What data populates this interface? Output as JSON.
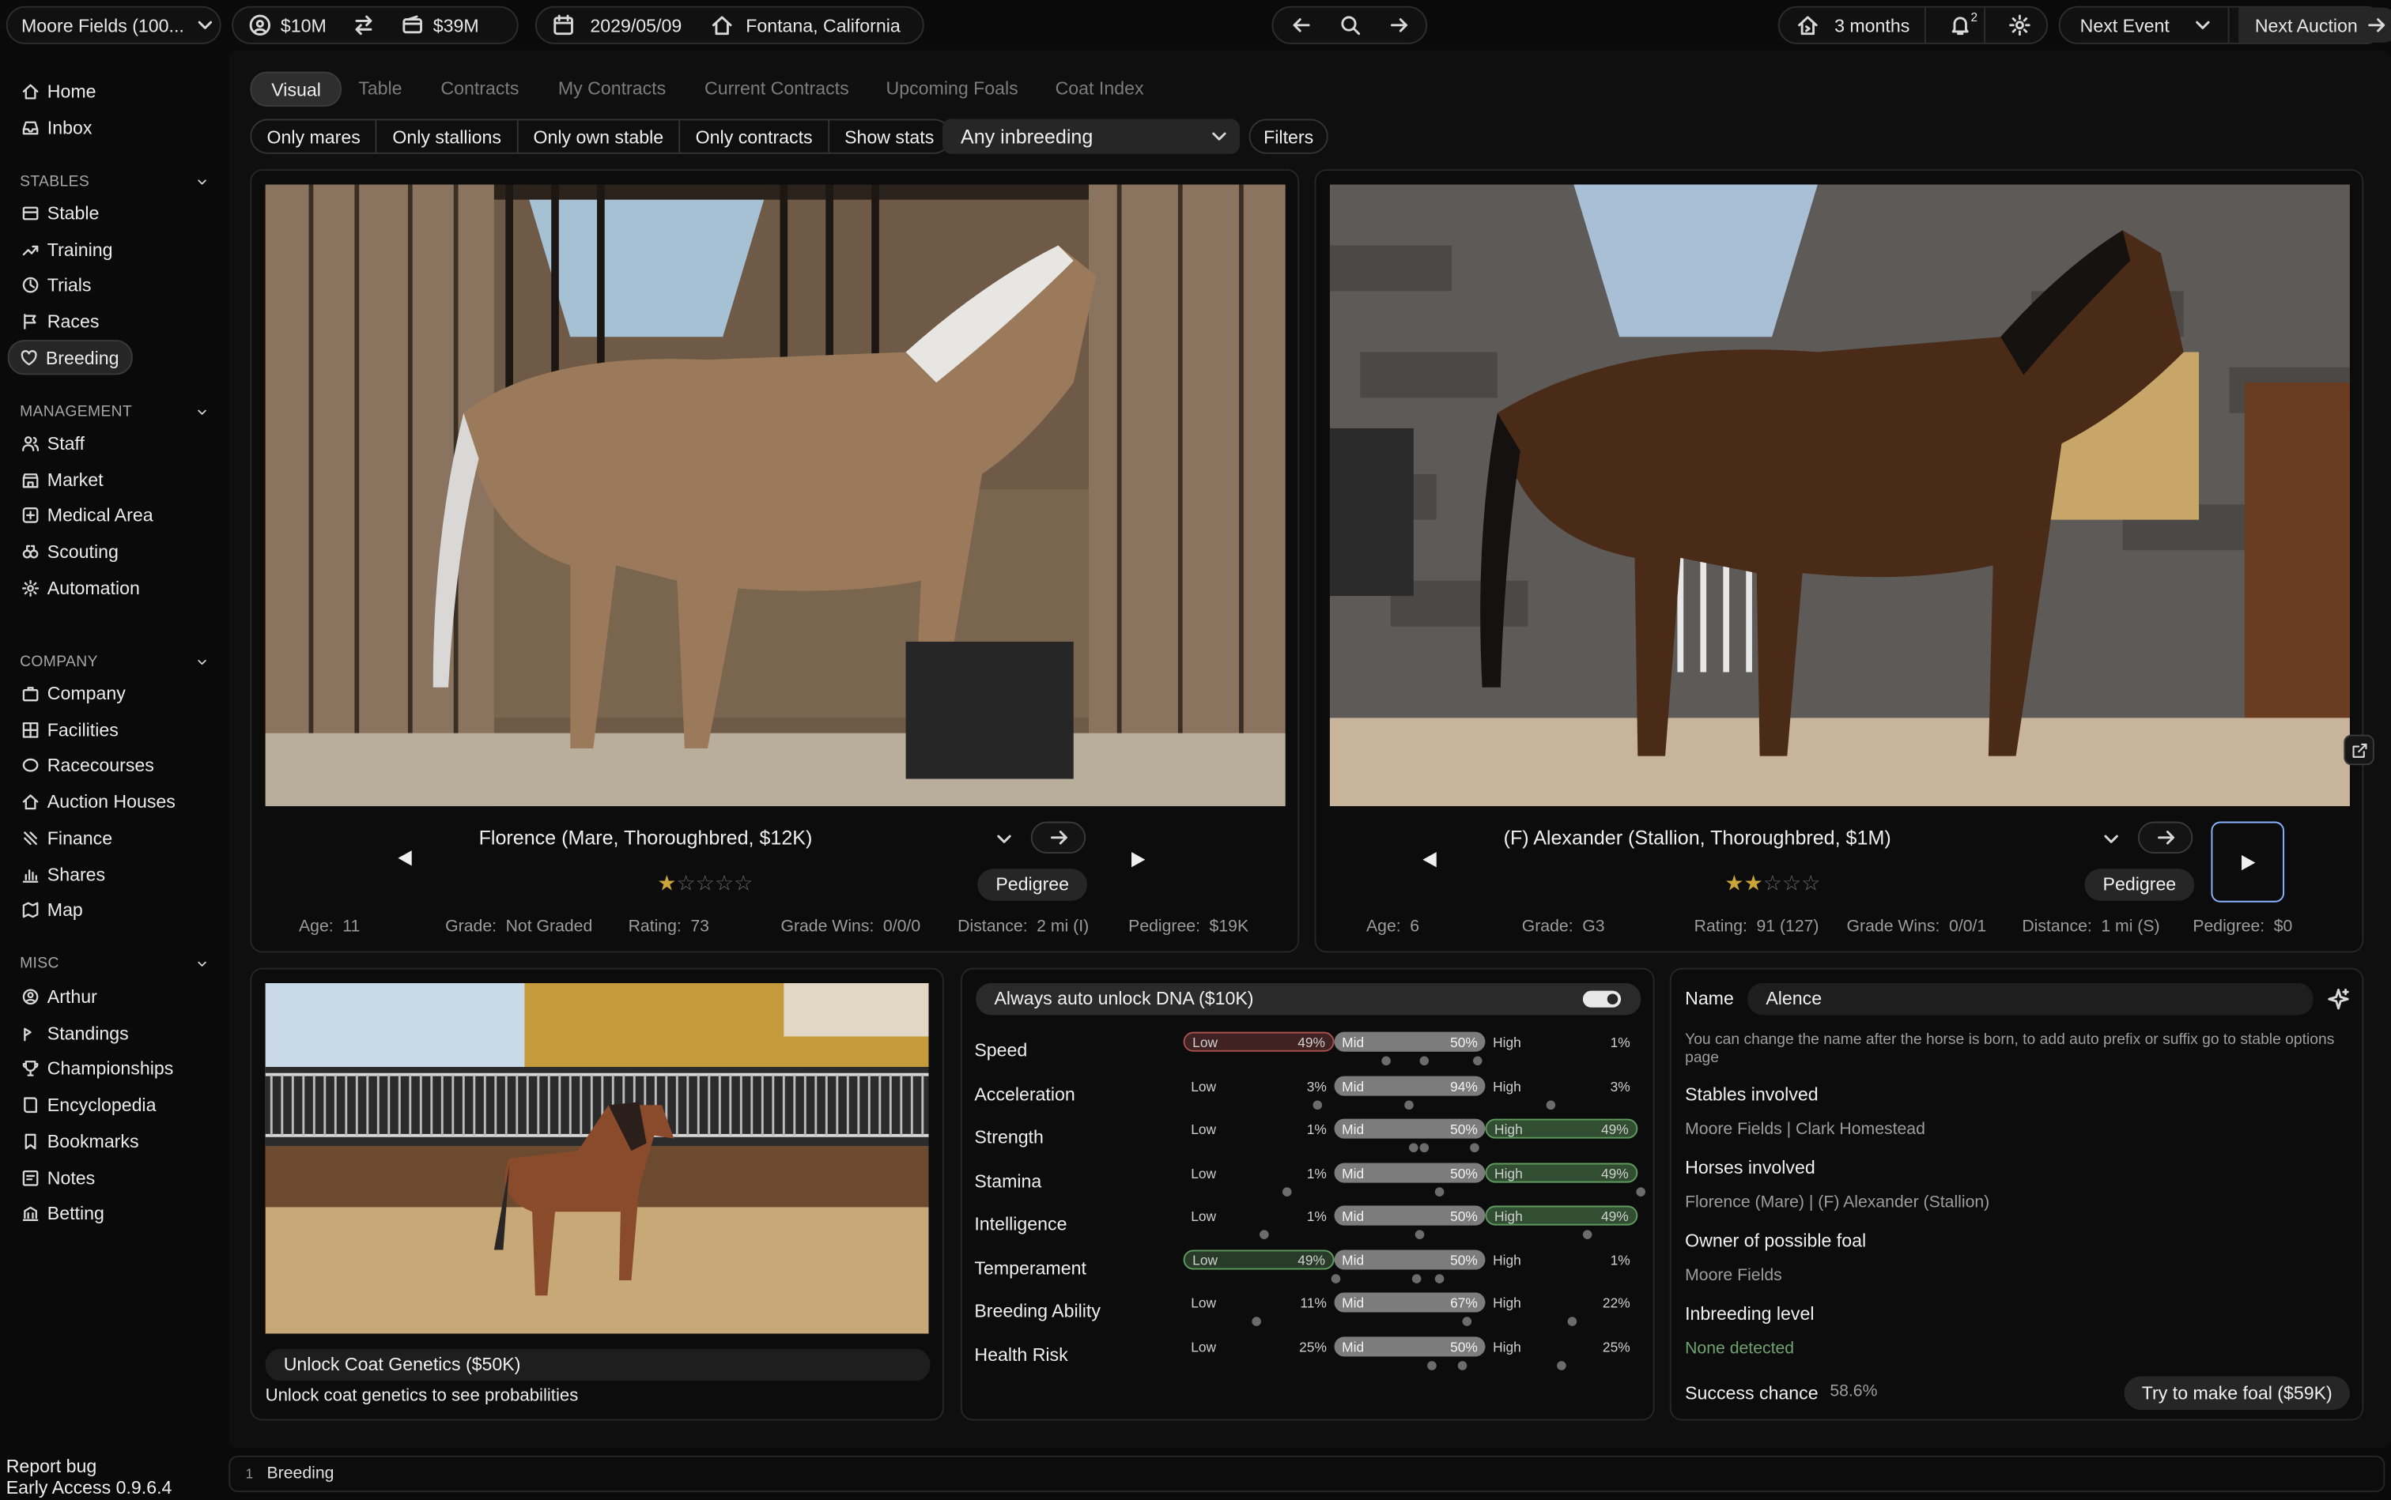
{
  "topbar": {
    "stable_name": "Moore Fields (100...",
    "cash": "$10M",
    "net_worth": "$39M",
    "date": "2029/05/09",
    "location": "Fontana, California",
    "duration": "3 months",
    "notification_count": "2",
    "next_event": "Next Event",
    "next_auction": "Next Auction"
  },
  "sidebar": {
    "top": [
      {
        "label": "Home",
        "icon": "home-icon"
      },
      {
        "label": "Inbox",
        "icon": "inbox-icon"
      }
    ],
    "sections": [
      {
        "title": "STABLES",
        "items": [
          "Stable",
          "Training",
          "Trials",
          "Races",
          "Breeding"
        ]
      },
      {
        "title": "MANAGEMENT",
        "items": [
          "Staff",
          "Market",
          "Medical Area",
          "Scouting",
          "Automation"
        ]
      },
      {
        "title": "COMPANY",
        "items": [
          "Company",
          "Facilities",
          "Racecourses",
          "Auction Houses",
          "Finance",
          "Shares",
          "Map"
        ]
      },
      {
        "title": "MISC",
        "items": [
          "Arthur",
          "Standings",
          "Championships",
          "Encyclopedia",
          "Bookmarks",
          "Notes",
          "Betting"
        ]
      }
    ],
    "report_bug": "Report bug",
    "version": "Early Access 0.9.6.4"
  },
  "tabs": [
    "Visual",
    "Table",
    "Contracts",
    "My Contracts",
    "Current Contracts",
    "Upcoming Foals",
    "Coat Index"
  ],
  "filters": [
    "Only mares",
    "Only stallions",
    "Only own stable",
    "Only contracts",
    "Show stats"
  ],
  "inbreeding_select": "Any inbreeding",
  "filters_button": "Filters",
  "mare": {
    "title": "Florence (Mare, Thoroughbred, $12K)",
    "stars": 1,
    "pedigree_button": "Pedigree",
    "stats": {
      "age_label": "Age:",
      "age": "11",
      "grade_label": "Grade:",
      "grade": "Not Graded",
      "rating_label": "Rating:",
      "rating": "73",
      "wins_label": "Grade Wins:",
      "wins": "0/0/0",
      "distance_label": "Distance:",
      "distance": "2 mi (I)",
      "pedigree_label": "Pedigree:",
      "pedigree": "$19K"
    }
  },
  "stallion": {
    "title": "(F) Alexander (Stallion, Thoroughbred, $1M)",
    "stars": 2,
    "pedigree_button": "Pedigree",
    "stats": {
      "age_label": "Age:",
      "age": "6",
      "grade_label": "Grade:",
      "grade": "G3",
      "rating_label": "Rating:",
      "rating": "91 (127)",
      "wins_label": "Grade Wins:",
      "wins": "0/0/1",
      "distance_label": "Distance:",
      "distance": "1 mi (S)",
      "pedigree_label": "Pedigree:",
      "pedigree": "$0"
    }
  },
  "foal": {
    "unlock_button": "Unlock Coat Genetics ($50K)",
    "hint": "Unlock coat genetics to see probabilities"
  },
  "dna": {
    "toggle_label": "Always auto unlock DNA ($10K)",
    "low_label": "Low",
    "mid_label": "Mid",
    "high_label": "High",
    "traits": [
      {
        "name": "Speed",
        "low": "49%",
        "mid": "50%",
        "high": "1%",
        "hi": "low",
        "accent": "red"
      },
      {
        "name": "Acceleration",
        "low": "3%",
        "mid": "94%",
        "high": "3%",
        "hi": "mid",
        "accent": "gray"
      },
      {
        "name": "Strength",
        "low": "1%",
        "mid": "50%",
        "high": "49%",
        "hi": "mid-high",
        "accent": "green"
      },
      {
        "name": "Stamina",
        "low": "1%",
        "mid": "50%",
        "high": "49%",
        "hi": "mid-high",
        "accent": "green"
      },
      {
        "name": "Intelligence",
        "low": "1%",
        "mid": "50%",
        "high": "49%",
        "hi": "mid-high",
        "accent": "green"
      },
      {
        "name": "Temperament",
        "low": "49%",
        "mid": "50%",
        "high": "1%",
        "hi": "low-mid",
        "accent": "green"
      },
      {
        "name": "Breeding Ability",
        "low": "11%",
        "mid": "67%",
        "high": "22%",
        "hi": "mid",
        "accent": "gray"
      },
      {
        "name": "Health Risk",
        "low": "25%",
        "mid": "50%",
        "high": "25%",
        "hi": "mid",
        "accent": "gray"
      }
    ]
  },
  "foal_info": {
    "name_label": "Name",
    "name_value": "Alence",
    "name_hint": "You can change the name after the horse is born, to add auto prefix or suffix go to stable options page",
    "stables_label": "Stables involved",
    "stables_value": "Moore Fields | Clark Homestead",
    "horses_label": "Horses involved",
    "horses_value": "Florence (Mare) | (F) Alexander (Stallion)",
    "owner_label": "Owner of possible foal",
    "owner_value": "Moore Fields",
    "inbreeding_label": "Inbreeding level",
    "inbreeding_value": "None detected",
    "success_label": "Success chance",
    "success_value": "58.6%",
    "try_button": "Try to make foal ($59K)"
  },
  "footer": {
    "index": "1",
    "page": "Breeding"
  },
  "colors": {
    "bg": "#0a0a0a",
    "panel": "#0c0c0c",
    "green": "#6ea36e",
    "red": "#b15a5a",
    "gold": "#c9a53a"
  }
}
